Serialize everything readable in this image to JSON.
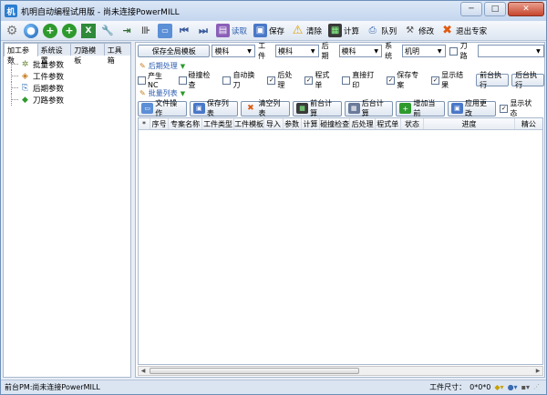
{
  "window": {
    "title": "机明自动编程试用版 - 尚未连接PowerMILL",
    "buttons": [
      "─",
      "□",
      "✕"
    ]
  },
  "toolbar": {
    "labeled": [
      {
        "label": "读取",
        "icon": "folder-open-icon"
      },
      {
        "label": "保存",
        "icon": "save-icon"
      },
      {
        "label": "清除",
        "icon": "warning-icon"
      },
      {
        "label": "计算",
        "icon": "calculate-icon"
      },
      {
        "label": "队列",
        "icon": "queue-icon"
      },
      {
        "label": "修改",
        "icon": "modify-icon"
      },
      {
        "label": "退出专家",
        "icon": "exit-icon"
      }
    ]
  },
  "left_panel": {
    "tabs": [
      "加工参数",
      "系统设置",
      "刀路模板",
      "工具箱"
    ],
    "tree": [
      "批量参数",
      "工件参数",
      "后期参数",
      "刀路参数"
    ]
  },
  "main": {
    "save_template": "保存全局模板",
    "template_value": "模科",
    "workpiece_label": "工件",
    "workpiece_value": "模科",
    "post_label": "后期",
    "post_value": "模科",
    "system_label": "系统",
    "system_value": "机明",
    "toolpath_label": "刀路",
    "post_section": "后期处理",
    "batch_section": "批量列表",
    "options": [
      {
        "label": "产生NC",
        "checked": false
      },
      {
        "label": "碰撞检查",
        "checked": false
      },
      {
        "label": "自动换刀",
        "checked": false
      },
      {
        "label": "后处理",
        "checked": true
      },
      {
        "label": "程式单",
        "checked": true
      },
      {
        "label": "直接打印",
        "checked": false
      },
      {
        "label": "保存专案",
        "checked": true
      },
      {
        "label": "显示结果",
        "checked": true
      }
    ],
    "front_exec": "前台执行",
    "back_exec": "后台执行",
    "buttons": [
      "文件操作",
      "保存列表",
      "清空列表",
      "前台计算",
      "后台计算",
      "增加当前",
      "应用更改"
    ],
    "show_status": "显示状态",
    "columns": [
      "*",
      "序号",
      "专案名称",
      "工件类型",
      "工件模板",
      "导入",
      "参数",
      "计算",
      "碰撞检查",
      "后处理",
      "程式单",
      "状态",
      "进度",
      "精公"
    ]
  },
  "status": {
    "left": "前台PM:尚未连接PowerMILL",
    "size_label": "工件尺寸：",
    "size_value": "0*0*0"
  }
}
